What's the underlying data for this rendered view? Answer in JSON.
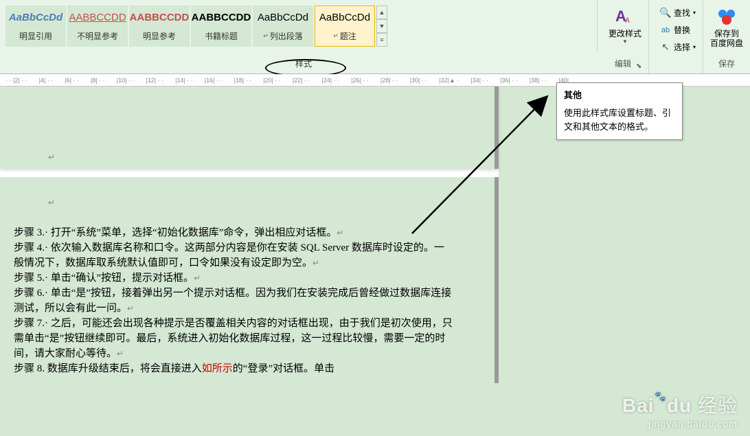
{
  "styles_gallery": [
    {
      "preview": "AaBbCcDd",
      "label": "明显引用"
    },
    {
      "preview": "AABBCCDD",
      "label": "不明显参考"
    },
    {
      "preview": "AABBCCDD",
      "label": "明显参考"
    },
    {
      "preview": "AABBCCDD",
      "label": "书籍标题"
    },
    {
      "preview": "AaBbCcDd",
      "label": "列出段落",
      "arrow": "↵"
    },
    {
      "preview": "AaBbCcDd",
      "label": "题注",
      "arrow": "↵"
    }
  ],
  "change_styles_label": "更改样式",
  "edit": {
    "find": "查找",
    "replace": "替换",
    "select": "选择"
  },
  "save": {
    "line1": "保存到",
    "line2": "百度网盘"
  },
  "group_labels": {
    "styles": "样式",
    "edit": "编辑",
    "save": "保存"
  },
  "tooltip": {
    "title": "其他",
    "body": "使用此样式库设置标题、引文和其他文本的格式。"
  },
  "ruler": [
    "2",
    "4",
    "6",
    "8",
    "10",
    "12",
    "14",
    "16",
    "18",
    "20",
    "22",
    "24",
    "26",
    "28",
    "30",
    "32",
    "34",
    "36",
    "38",
    "40"
  ],
  "document": {
    "lines": [
      "步骤 3.· 打开“系统”菜单，选择“初始化数据库”命令，弹出相应对话框。",
      "步骤 4.· 依次输入数据库名称和口令。这两部分内容是你在安装 SQL Server 数据库时设定的。一般情况下，数据库取系统默认值即可，口令如果没有设定即为空。",
      "步骤 5.· 单击“确认”按钮，提示对话框。",
      "步骤 6.· 单击“是”按钮，接着弹出另一个提示对话框。因为我们在安装完成后曾经做过数据库连接测试，所以会有此一问。",
      "步骤 7.· 之后，可能还会出现各种提示是否覆盖相关内容的对话框出现，由于我们是初次使用，只需单击“是”按钮继续即可。最后，系统进入初始化数据库过程，这一过程比较慢，需要一定的时间，请大家耐心等待。"
    ],
    "partial": {
      "pre": "步骤 8. 数据库升级结束后，将会直接进入",
      "red": "如所示",
      "post": "的“登录”对话框。单击"
    }
  },
  "watermark": {
    "main": "Baidu 经验",
    "sub": "jingyan.baidu.com"
  }
}
